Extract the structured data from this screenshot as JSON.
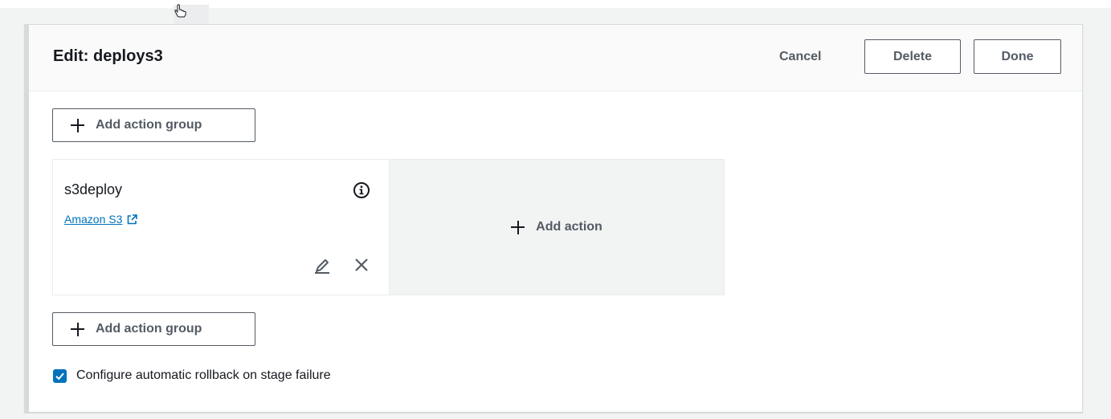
{
  "header": {
    "title": "Edit: deploys3",
    "cancel_label": "Cancel",
    "delete_label": "Delete",
    "done_label": "Done"
  },
  "add_action_group_label": "Add action group",
  "action": {
    "name": "s3deploy",
    "provider": "Amazon S3"
  },
  "add_action_label": "Add action",
  "rollback": {
    "checked": true,
    "label": "Configure automatic rollback on stage failure"
  },
  "colors": {
    "link": "#0073bb",
    "checkbox": "#0073bb",
    "button_text": "#545b64",
    "panel_header_bg": "#fafafa",
    "add_action_bg": "#f2f3f3"
  },
  "icons": {
    "plus": "plus-icon",
    "info": "info-icon",
    "external_link": "external-link-icon",
    "edit": "pencil-icon",
    "remove": "close-icon",
    "checkbox": "checkmark-icon",
    "cursor": "hand-cursor-icon"
  }
}
